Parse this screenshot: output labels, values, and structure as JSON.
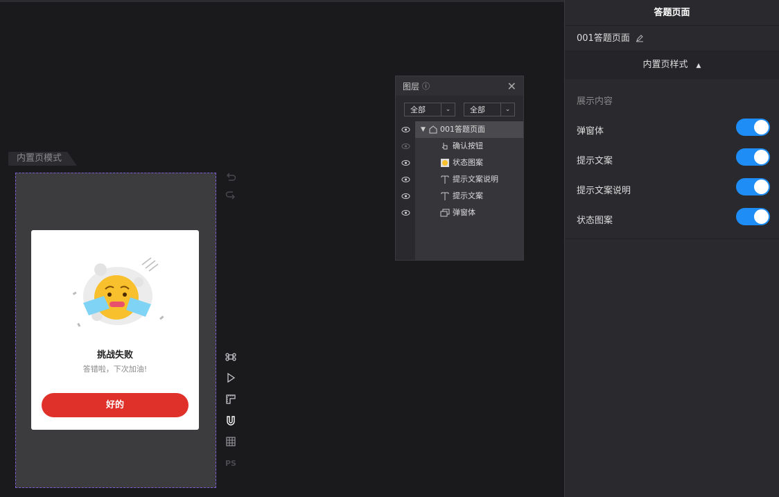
{
  "canvas": {
    "mode_tag": "内置页模式"
  },
  "popup": {
    "title": "挑战失败",
    "description": "答错啦，下次加油!",
    "button_label": "好的"
  },
  "tools": {
    "ps_label": "PS"
  },
  "layers_panel": {
    "title": "图层",
    "filter_1": "全部",
    "filter_2": "全部",
    "items": [
      {
        "label": "001答题页面",
        "icon": "page-icon",
        "selected": true
      },
      {
        "label": "确认按钮",
        "icon": "click-icon"
      },
      {
        "label": "状态图案",
        "icon": "image-icon"
      },
      {
        "label": "提示文案说明",
        "icon": "text-icon"
      },
      {
        "label": "提示文案",
        "icon": "text-icon"
      },
      {
        "label": "弹窗体",
        "icon": "popup-icon"
      }
    ]
  },
  "properties": {
    "panel_title": "答题页面",
    "page_name": "001答题页面",
    "section_label": "内置页样式",
    "subsection_label": "展示内容",
    "toggles": [
      {
        "label": "弹窗体",
        "on": true
      },
      {
        "label": "提示文案",
        "on": true
      },
      {
        "label": "提示文案说明",
        "on": true
      },
      {
        "label": "状态图案",
        "on": true
      }
    ]
  },
  "colors": {
    "accent": "#1e8df5",
    "button_red": "#e0302a",
    "artboard_border": "#7b5cd6"
  }
}
